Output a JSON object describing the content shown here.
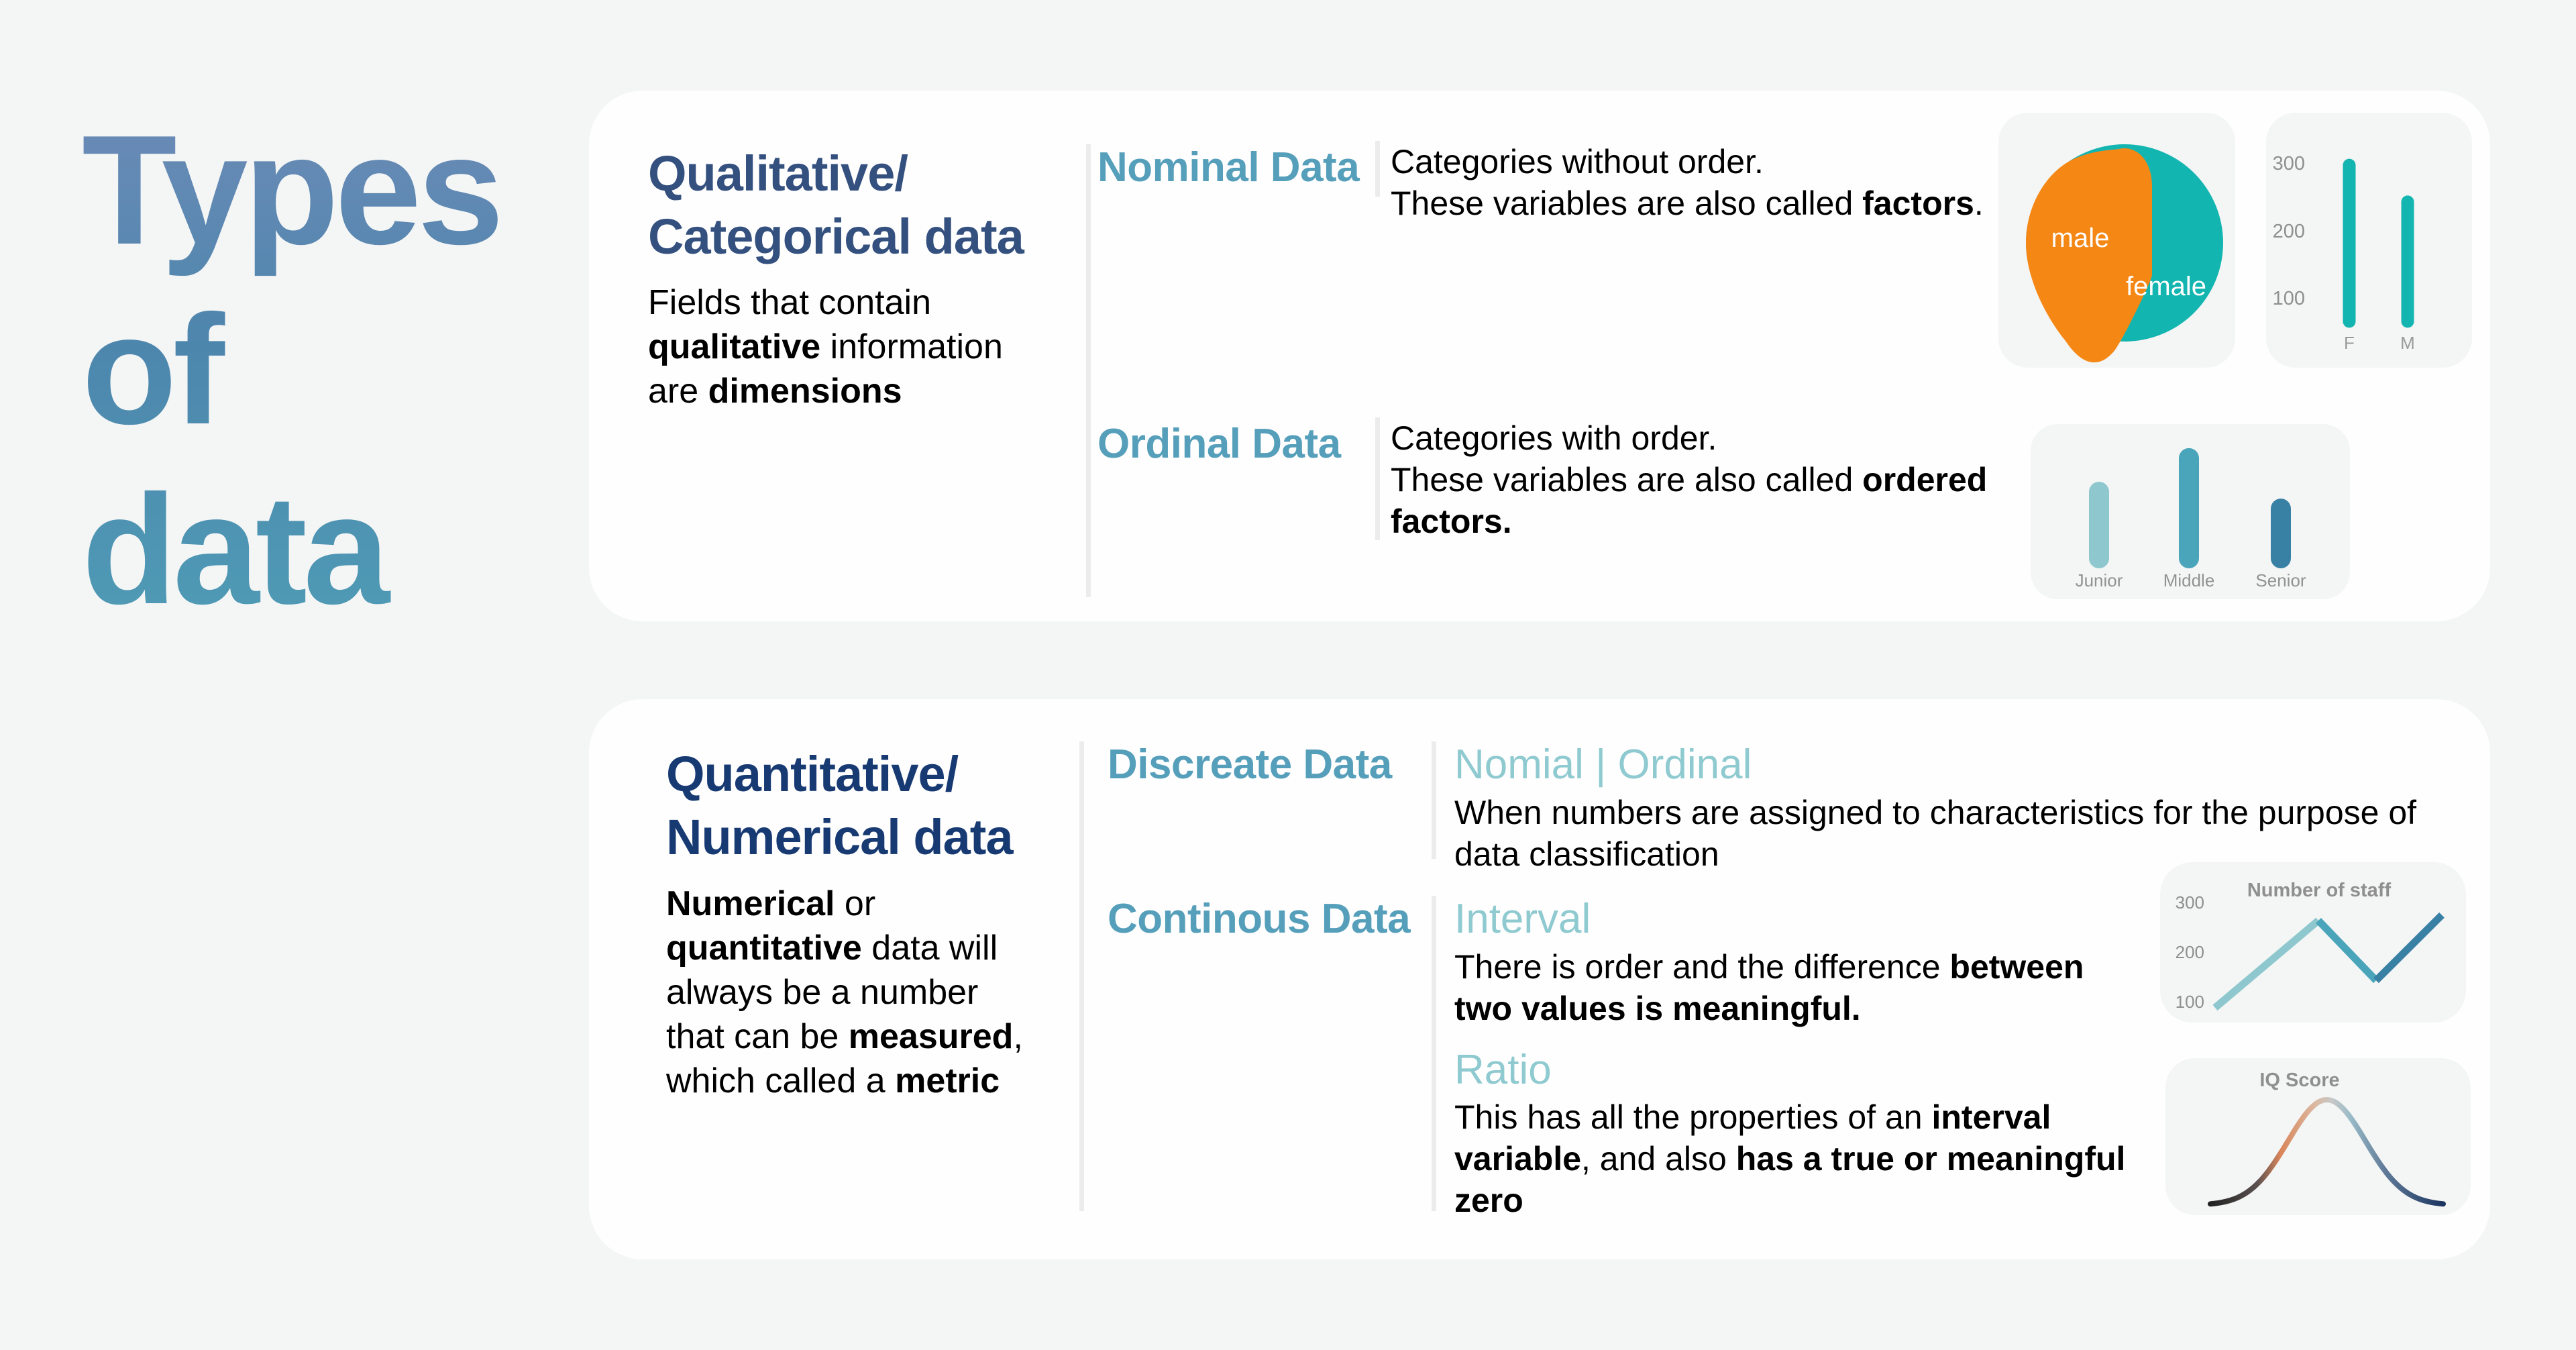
{
  "title": {
    "line1": "Types",
    "line2": "of",
    "line3": "data"
  },
  "qualitative": {
    "heading_line1": "Qualitative/",
    "heading_line2": "Categorical data",
    "description": {
      "l1": "Fields that contain",
      "l2_bold": "qualitative",
      "l2_rest": " information",
      "l3_pre": "are ",
      "l3_bold": "dimensions"
    },
    "nominal": {
      "label": "Nominal Data",
      "line1": "Categories without order.",
      "line2_pre": "These variables are also called ",
      "line2_bold": "factors",
      "line2_post": "."
    },
    "ordinal": {
      "label": "Ordinal Data",
      "line1": "Categories with order.",
      "line2_pre": "These variables are also called ",
      "line2_bold": "ordered",
      "line3_bold": "factors."
    }
  },
  "quantitative": {
    "heading_line1": "Quantitative/",
    "heading_line2": "Numerical data",
    "description": {
      "l1_bold": "Numerical",
      "l1_rest": " or",
      "l2_bold": "quantitative",
      "l2_rest": " data will",
      "l3": "always be a number",
      "l4_pre": "that can be ",
      "l4_bold": "measured",
      "l4_post": ",",
      "l5_pre": "which called a ",
      "l5_bold": "metric"
    },
    "discrete": {
      "label": "Discreate Data",
      "sub_label": "Nomial | Ordinal",
      "line1": "When numbers are assigned to characteristics for the purpose of",
      "line2": "data classification"
    },
    "continuous": {
      "label": "Continous Data",
      "interval": {
        "label": "Interval",
        "line1_pre": "There is order and the difference ",
        "line1_bold": "between",
        "line2_bold": "two values is meaningful."
      },
      "ratio": {
        "label": "Ratio",
        "line1_pre": "This has all the properties of an ",
        "line1_bold": "interval",
        "line2_bold1": "variable",
        "line2_mid": ", and also ",
        "line2_bold2": "has a true or meaningful",
        "line3_bold": "zero"
      }
    }
  },
  "colors": {
    "background": "#f4f5f5",
    "card": "#fefefe",
    "teal": "#13b5b0",
    "orange": "#f58715",
    "light_teal": "#8ec8ce",
    "mid_teal": "#4aa5bb",
    "dark_teal": "#3880a4"
  },
  "chart_data": [
    {
      "type": "pie",
      "title": "",
      "labels": [
        "male",
        "female"
      ],
      "values": [
        40,
        60
      ],
      "colors": [
        "#f58715",
        "#13b5b0"
      ]
    },
    {
      "type": "bar",
      "title": "",
      "categories": [
        "F",
        "M"
      ],
      "values": [
        300,
        240
      ],
      "yticks": [
        100,
        200,
        300
      ],
      "ylim": [
        25,
        310
      ],
      "colors": [
        "#13b5b0",
        "#13b5b0"
      ]
    },
    {
      "type": "bar",
      "title": "",
      "categories": [
        "Junior",
        "Middle",
        "Senior"
      ],
      "values": [
        180,
        250,
        145
      ],
      "yticks": [],
      "ylim": [
        0,
        300
      ],
      "colors": [
        "#8ec8ce",
        "#4aa5bb",
        "#3880a4"
      ]
    },
    {
      "type": "line",
      "title": "Number of staff",
      "x": [
        1,
        2,
        3,
        4
      ],
      "values": [
        80,
        240,
        130,
        250
      ],
      "yticks": [
        100,
        200,
        300
      ],
      "ylim": [
        70,
        310
      ],
      "segment_colors": [
        "#8ec8ce",
        "#4aa5bb",
        "#3880a4"
      ]
    },
    {
      "type": "line",
      "title": "IQ Score",
      "x": [
        -3,
        -2.5,
        -2,
        -1.5,
        -1,
        -0.5,
        0,
        0.5,
        1,
        1.5,
        2,
        2.5,
        3
      ],
      "values": [
        0.011,
        0.044,
        0.135,
        0.325,
        0.607,
        0.882,
        1.0,
        0.882,
        0.607,
        0.325,
        0.135,
        0.044,
        0.011
      ],
      "distribution": "normal (bell curve)",
      "gradient_colors": [
        "#222222",
        "#d9855a",
        "#c8c8c8",
        "#8fb0c0",
        "#5a7595",
        "#1b3560"
      ]
    }
  ]
}
